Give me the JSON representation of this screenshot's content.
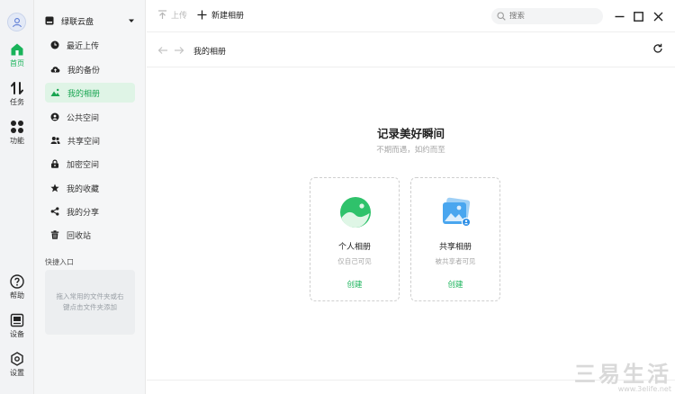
{
  "rail": {
    "items": [
      {
        "label": "首页"
      },
      {
        "label": "任务"
      },
      {
        "label": "功能"
      },
      {
        "label": "帮助"
      },
      {
        "label": "设备"
      },
      {
        "label": "设置"
      }
    ]
  },
  "sidebar": {
    "header": "绿联云盘",
    "items": [
      {
        "label": "最近上传",
        "icon": "clock-icon"
      },
      {
        "label": "我的备份",
        "icon": "cloud-upload-icon"
      },
      {
        "label": "我的相册",
        "icon": "photo-icon"
      },
      {
        "label": "公共空间",
        "icon": "public-space-icon"
      },
      {
        "label": "共享空间",
        "icon": "people-icon"
      },
      {
        "label": "加密空间",
        "icon": "lock-icon"
      },
      {
        "label": "我的收藏",
        "icon": "star-icon"
      },
      {
        "label": "我的分享",
        "icon": "share-icon"
      },
      {
        "label": "回收站",
        "icon": "trash-icon"
      }
    ],
    "quick_title": "快捷入口",
    "quick_hint_line1": "拖入常用的文件夹或右",
    "quick_hint_line2": "键点击文件夹添加"
  },
  "toolbar": {
    "upload_label": "上传",
    "new_album_label": "新建相册",
    "search_placeholder": "搜索"
  },
  "breadcrumb": {
    "current": "我的相册"
  },
  "hero": {
    "title": "记录美好瞬间",
    "subtitle": "不期而遇，如约而至"
  },
  "cards": [
    {
      "name": "个人相册",
      "desc": "仅自己可见",
      "action": "创建"
    },
    {
      "name": "共享相册",
      "desc": "被共享者可见",
      "action": "创建"
    }
  ],
  "watermark": {
    "text": "三易生活",
    "url": "www.3elife.net"
  },
  "colors": {
    "accent": "#19b35a",
    "active_bg": "#dff4e6"
  }
}
